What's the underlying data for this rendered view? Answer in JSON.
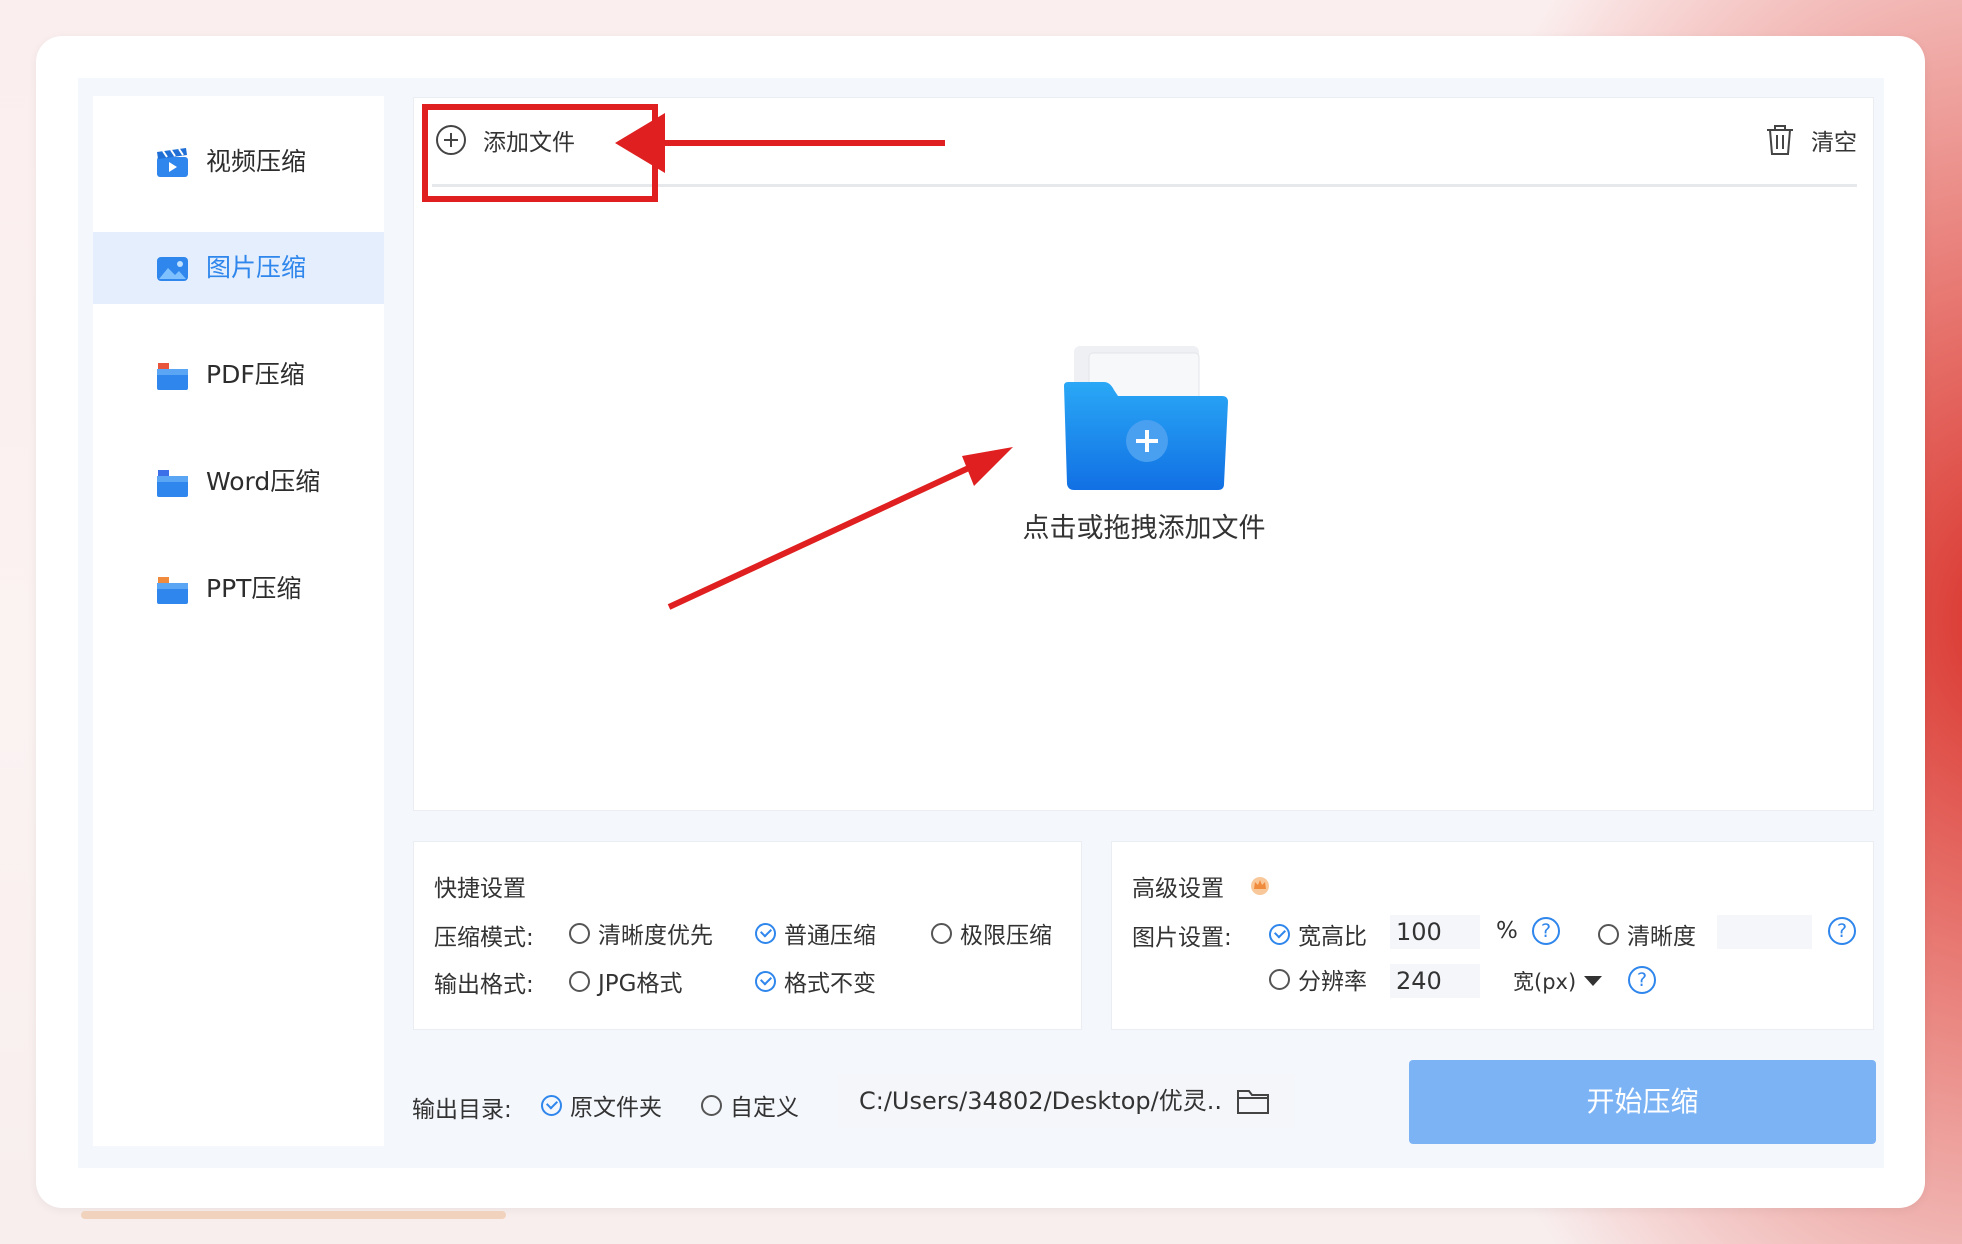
{
  "sidebar": {
    "items": [
      {
        "label": "视频压缩",
        "icon": "video-clapper-icon",
        "active": false
      },
      {
        "label": "图片压缩",
        "icon": "image-icon",
        "active": true
      },
      {
        "label": "PDF压缩",
        "icon": "pdf-file-icon",
        "active": false
      },
      {
        "label": "Word压缩",
        "icon": "word-file-icon",
        "active": false
      },
      {
        "label": "PPT压缩",
        "icon": "ppt-file-icon",
        "active": false
      }
    ]
  },
  "toolbar": {
    "add_label": "添加文件",
    "clear_label": "清空"
  },
  "dropzone": {
    "text": "点击或拖拽添加文件"
  },
  "quick_settings": {
    "title": "快捷设置",
    "mode_label": "压缩模式:",
    "modes": [
      {
        "label": "清晰度优先",
        "checked": false
      },
      {
        "label": "普通压缩",
        "checked": true
      },
      {
        "label": "极限压缩",
        "checked": false
      }
    ],
    "format_label": "输出格式:",
    "formats": [
      {
        "label": "JPG格式",
        "checked": false
      },
      {
        "label": "格式不变",
        "checked": true
      }
    ]
  },
  "advanced_settings": {
    "title": "高级设置",
    "image_label": "图片设置:",
    "ratio": {
      "label": "宽高比",
      "value": "100",
      "unit": "%",
      "checked": true
    },
    "clarity": {
      "label": "清晰度",
      "value": "",
      "checked": false
    },
    "resolution": {
      "label": "分辨率",
      "value": "240",
      "unit": "宽(px)",
      "checked": false
    },
    "help": "?"
  },
  "output": {
    "label": "输出目录:",
    "options": [
      {
        "label": "原文件夹",
        "checked": true
      },
      {
        "label": "自定义",
        "checked": false
      }
    ],
    "path": "C:/Users/34802/Desktop/优灵.."
  },
  "start_button": "开始压缩",
  "colors": {
    "accent": "#2f86ec",
    "start_button": "#7cb3f5",
    "annotation": "#e02020"
  }
}
